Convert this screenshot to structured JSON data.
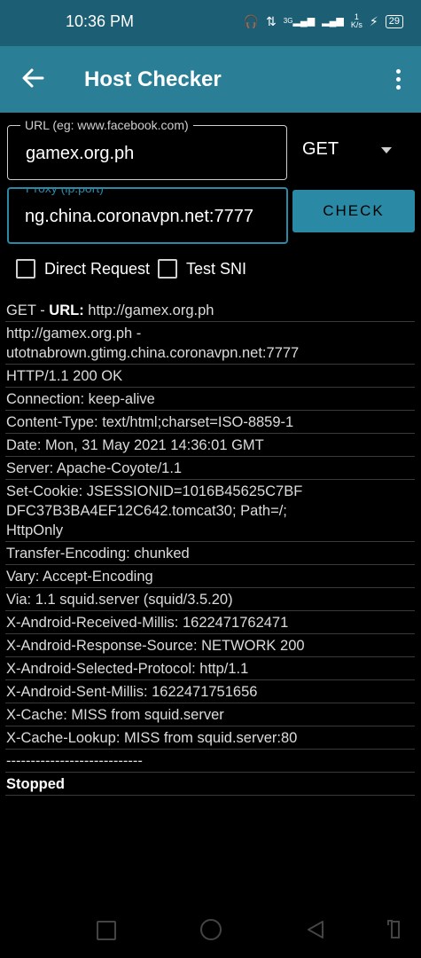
{
  "status_bar": {
    "time": "10:36 PM",
    "net_type": "3G",
    "net_speed_value": "1",
    "net_speed_unit": "K/s",
    "battery": "29"
  },
  "app_bar": {
    "title": "Host Checker"
  },
  "form": {
    "url_label": "URL (eg: www.facebook.com)",
    "url_value": "gamex.org.ph",
    "proxy_label": "Proxy (ip:port)",
    "proxy_value": "ng.china.coronavpn.net:7777",
    "method": "GET",
    "check_button": "CHECK",
    "direct_request_label": "Direct Request",
    "test_sni_label": "Test SNI"
  },
  "log": {
    "first_prefix": "GET - ",
    "first_bold": "URL:",
    "first_rest": " http://gamex.org.ph",
    "lines": [
      "http://gamex.org.ph -\nutotnabrown.gtimg.china.coronavpn.net:7777",
      "HTTP/1.1 200 OK",
      "Connection: keep-alive",
      "Content-Type: text/html;charset=ISO-8859-1",
      "Date: Mon, 31 May 2021 14:36:01 GMT",
      "Server: Apache-Coyote/1.1",
      "Set-Cookie: JSESSIONID=1016B45625C7BF\nDFC37B3BA4EF12C642.tomcat30; Path=/;\nHttpOnly",
      "Transfer-Encoding: chunked",
      "Vary: Accept-Encoding",
      "Via: 1.1 squid.server (squid/3.5.20)",
      "X-Android-Received-Millis: 1622471762471",
      "X-Android-Response-Source: NETWORK 200",
      "X-Android-Selected-Protocol: http/1.1",
      "X-Android-Sent-Millis: 1622471751656",
      "X-Cache: MISS from squid.server",
      "X-Cache-Lookup: MISS from squid.server:80",
      "----------------------------"
    ],
    "final_status": "Stopped"
  }
}
